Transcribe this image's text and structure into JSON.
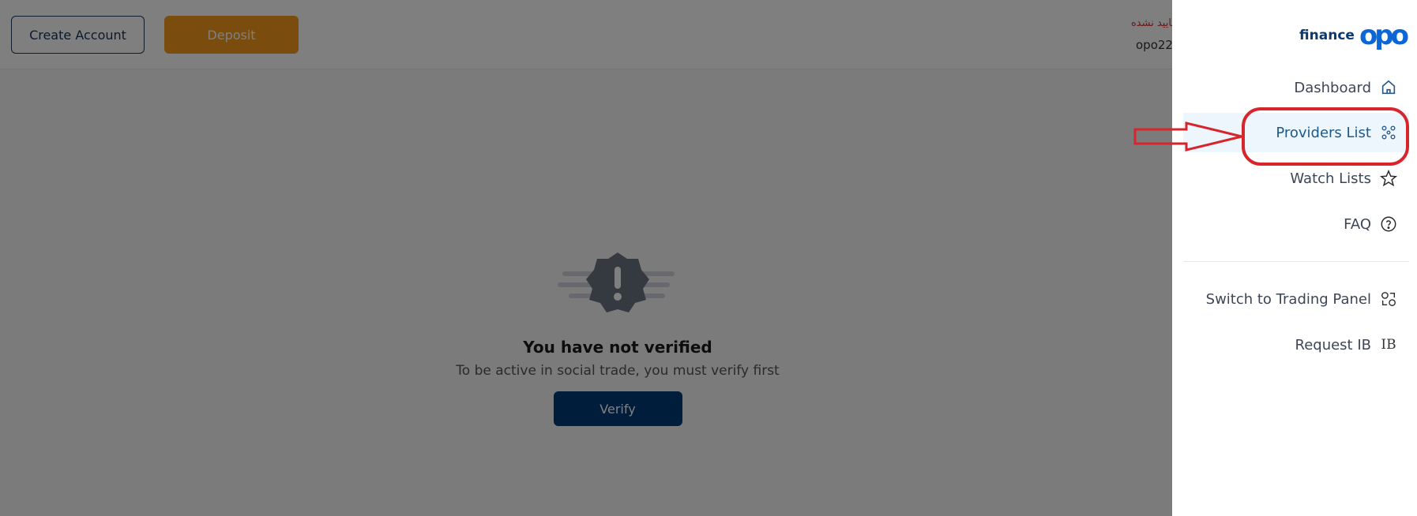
{
  "topbar": {
    "create_account_label": "Create Account",
    "deposit_label": "Deposit",
    "user_status": "تایید نشده",
    "user_name": "opo22"
  },
  "empty_state": {
    "title": "You have not verified",
    "subtitle": "To be active in social trade, you must verify first",
    "verify_label": "Verify"
  },
  "sidebar": {
    "logo_text": "finance",
    "logo_mark": "opo",
    "items": [
      {
        "label": "Dashboard",
        "icon": "home-icon"
      },
      {
        "label": "Providers List",
        "icon": "providers-icon",
        "active": true
      },
      {
        "label": "Watch Lists",
        "icon": "star-icon"
      },
      {
        "label": "FAQ",
        "icon": "question-icon"
      }
    ],
    "secondary": [
      {
        "label": "Switch to Trading Panel",
        "icon": "switch-icon"
      },
      {
        "label": "Request IB",
        "icon": "ib-icon",
        "icon_text": "IB"
      }
    ]
  },
  "colors": {
    "accent": "#1c5a8b",
    "deposit": "#f59a1c",
    "verify": "#003a78",
    "annotation": "#d8252b"
  }
}
